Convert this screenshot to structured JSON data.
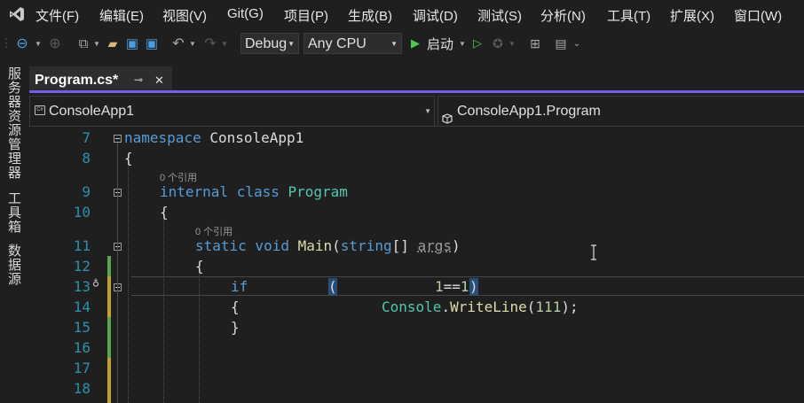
{
  "menu": [
    "文件(F)",
    "编辑(E)",
    "视图(V)",
    "Git(G)",
    "项目(P)",
    "生成(B)",
    "调试(D)",
    "测试(S)",
    "分析(N)",
    "工具(T)",
    "扩展(X)",
    "窗口(W)"
  ],
  "toolbar": {
    "config": "Debug",
    "platform": "Any CPU",
    "start_label": "启动"
  },
  "sidebar": {
    "tabs": [
      "服务器资源管理器",
      "工具箱",
      "数据源"
    ]
  },
  "tab": {
    "title": "Program.cs*",
    "pin": "⊸",
    "close": "✕"
  },
  "nav": {
    "project": "ConsoleApp1",
    "class": "ConsoleApp1.Program"
  },
  "editor": {
    "line_numbers": [
      "7",
      "8",
      "9",
      "10",
      "11",
      "12",
      "13",
      "14",
      "15",
      "16",
      "17",
      "18"
    ],
    "codelens_refs": "0 个引用",
    "lines": {
      "l7_kw": "namespace",
      "l7_name": " ConsoleApp1",
      "l8": "{",
      "l9_kw": "internal class",
      "l9_ty": " Program",
      "l10": "{",
      "l11_kw": "static void",
      "l11_fn": " Main",
      "l11_p1": "(",
      "l11_kw2": "string",
      "l11_p2": "[] ",
      "l11_arg": "args",
      "l11_p3": ")",
      "l12": "{",
      "l13_kw": "if",
      "l13_open": "(",
      "l13_num": "1",
      "l13_op": "==",
      "l13_num2": "1",
      "l13_close": ")",
      "l14_open": "{",
      "l14_ty": "Console",
      "l14_dot": ".",
      "l14_fn": "WriteLine",
      "l14_p": "(",
      "l14_num": "111",
      "l14_end": ");",
      "l15": "}"
    }
  },
  "colors": {
    "accent": "#7160e8",
    "keyword": "#569cd6",
    "type": "#4ec9b0",
    "method": "#dcdcaa",
    "line_number": "#2b91af",
    "changed_saved": "#57a64a",
    "changed_unsaved": "#c8a02e"
  }
}
